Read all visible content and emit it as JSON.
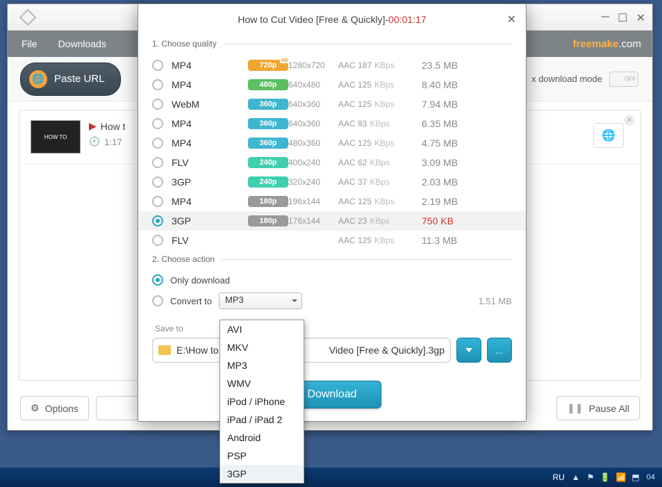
{
  "main": {
    "menu": {
      "file": "File",
      "downloads": "Downloads"
    },
    "brand": {
      "name": "freemake",
      "suffix": ".com"
    },
    "paste_label": "Paste URL",
    "dl_mode_label": "x download mode",
    "toggle_label": "OFF",
    "item": {
      "thumb_text": "HOW TO",
      "title_prefix": "How t",
      "duration": "1:17"
    },
    "footer": {
      "options": "Options",
      "pause_all": "Pause All"
    }
  },
  "dialog": {
    "title_text": "How to Cut Video [Free & Quickly]",
    "title_sep": " - ",
    "duration": "00:01:17",
    "section1": "1. Choose quality",
    "section2": "2. Choose action",
    "quality": [
      {
        "fmt": "MP4",
        "icon": "",
        "badge": "720p",
        "bclass": "b720 hd",
        "res": "1280x720",
        "audio": "AAC 187",
        "kbps": "KBps",
        "size": "23.5 MB",
        "sel": false
      },
      {
        "fmt": "MP4",
        "icon": "",
        "badge": "480p",
        "bclass": "b480",
        "res": "640x480",
        "audio": "AAC 125",
        "kbps": "KBps",
        "size": "8.40 MB",
        "sel": false
      },
      {
        "fmt": "WebM",
        "icon": "",
        "badge": "360p",
        "bclass": "b360",
        "res": "640x360",
        "audio": "AAC 125",
        "kbps": "KBps",
        "size": "7.94 MB",
        "sel": false
      },
      {
        "fmt": "MP4",
        "icon": "apple",
        "badge": "360p",
        "bclass": "b360",
        "res": "640x360",
        "audio": "AAC 93",
        "kbps": "KBps",
        "size": "6.35 MB",
        "sel": false
      },
      {
        "fmt": "MP4",
        "icon": "",
        "badge": "360p",
        "bclass": "b360",
        "res": "480x360",
        "audio": "AAC 125",
        "kbps": "KBps",
        "size": "4.75 MB",
        "sel": false
      },
      {
        "fmt": "FLV",
        "icon": "",
        "badge": "240p",
        "bclass": "b240",
        "res": "400x240",
        "audio": "AAC 62",
        "kbps": "KBps",
        "size": "3.09 MB",
        "sel": false
      },
      {
        "fmt": "3GP",
        "icon": "",
        "badge": "240p",
        "bclass": "b240",
        "res": "320x240",
        "audio": "AAC 37",
        "kbps": "KBps",
        "size": "2.03 MB",
        "sel": false
      },
      {
        "fmt": "MP4",
        "icon": "",
        "badge": "180p",
        "bclass": "b180",
        "res": "196x144",
        "audio": "AAC 125",
        "kbps": "KBps",
        "size": "2.19 MB",
        "sel": false
      },
      {
        "fmt": "3GP",
        "icon": "",
        "badge": "180p",
        "bclass": "b180",
        "res": "176x144",
        "audio": "AAC 23",
        "kbps": "KBps",
        "size": "750 KB",
        "sel": true,
        "size_red": true
      },
      {
        "fmt": "FLV",
        "icon": "",
        "badge": "",
        "bclass": "",
        "res": "",
        "audio": "AAC 125",
        "kbps": "KBps",
        "size": "11.3 MB",
        "sel": false
      }
    ],
    "action": {
      "only_download": "Only download",
      "convert_to": "Convert to",
      "convert_value": "MP3",
      "convert_size": "1.51 MB"
    },
    "save": {
      "label": "Save to",
      "path_left": "E:\\How to",
      "path_right": "Video [Free & Quickly].3gp",
      "browse": "..."
    },
    "download_label": "Download"
  },
  "dropdown": {
    "items": [
      "AVI",
      "MKV",
      "MP3",
      "WMV",
      "iPod / iPhone",
      "iPad / iPad 2",
      "Android",
      "PSP",
      "3GP"
    ],
    "hover_index": 8
  },
  "taskbar": {
    "lang": "RU",
    "time": "04"
  }
}
